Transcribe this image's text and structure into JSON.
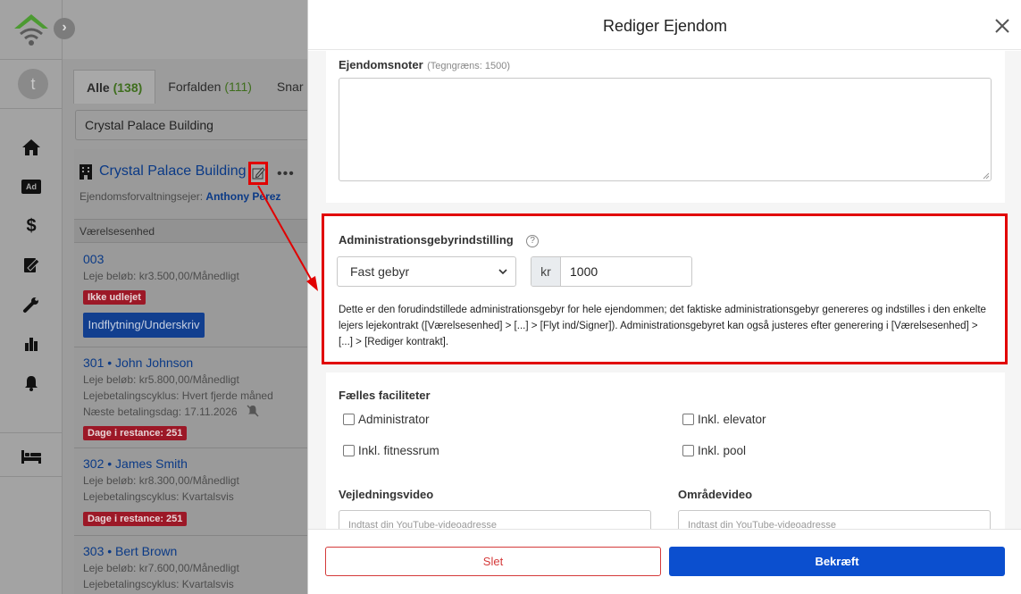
{
  "nav": {
    "avatar_letter": "t",
    "icons": [
      "home-icon",
      "ad-icon",
      "dollar-icon",
      "contract-icon",
      "wrench-icon",
      "chart-icon",
      "bell-icon",
      "bed-icon"
    ],
    "ad_label": "Ad"
  },
  "tabs": [
    {
      "label": "Alle",
      "count": "(138)"
    },
    {
      "label": "Forfalden",
      "count": "(111)"
    },
    {
      "label": "Snar b",
      "count": ""
    }
  ],
  "search": {
    "value": "Crystal Palace Building"
  },
  "property": {
    "name": "Crystal Palace Building",
    "owner_label": "Ejendomsforvaltningsejer:",
    "owner_name": "Anthony Perez",
    "section_header": "Værelsesenhed"
  },
  "units": [
    {
      "title": "003",
      "lines": [
        "Leje beløb: kr3.500,00/Månedligt"
      ],
      "badge": "Ikke udlejet",
      "button": "Indflytning/Underskriv"
    },
    {
      "title": "301 • John Johnson",
      "lines": [
        "Leje beløb: kr5.800,00/Månedligt",
        "Lejebetalingscyklus: Hvert fjerde måned",
        "Næste betalingsdag:  17.11.2026"
      ],
      "badge": "Dage i restance: 251"
    },
    {
      "title": "302 • James Smith",
      "lines": [
        "Leje beløb: kr8.300,00/Månedligt",
        "Lejebetalingscyklus: Kvartalsvis"
      ],
      "badge": "Dage i restance: 251"
    },
    {
      "title": "303 • Bert Brown",
      "lines": [
        "Leje beløb: kr7.600,00/Månedligt",
        "Lejebetalingscyklus: Kvartalsvis"
      ]
    }
  ],
  "modal": {
    "title": "Rediger Ejendom",
    "notes": {
      "label": "Ejendomsnoter",
      "hint": "(Tegngræns: 1500)",
      "value": ""
    },
    "admin_fee": {
      "label": "Administrationsgebyrindstilling",
      "help": "?",
      "type_selected": "Fast gebyr",
      "currency": "kr",
      "amount": "1000",
      "description": "Dette er den forudindstillede administrationsgebyr for hele ejendommen; det faktiske administrationsgebyr genereres og indstilles i den enkelte lejers lejekontrakt ([Værelsesenhed] > [...] > [Flyt ind/Signer]). Administrationsgebyret kan også justeres efter generering i [Værelsesenhed] > [...] > [Rediger kontrakt]."
    },
    "facilities": {
      "label": "Fælles faciliteter",
      "items": [
        {
          "label": "Administrator",
          "checked": false
        },
        {
          "label": "Inkl. elevator",
          "checked": false
        },
        {
          "label": "Inkl. fitnessrum",
          "checked": false
        },
        {
          "label": "Inkl. pool",
          "checked": false
        }
      ]
    },
    "guide_video": {
      "label": "Vejledningsvideo",
      "placeholder": "Indtast din YouTube-videoadresse"
    },
    "area_video": {
      "label": "Områdevideo",
      "placeholder": "Indtast din YouTube-videoadresse"
    },
    "delete_label": "Slet",
    "confirm_label": "Bekræft"
  },
  "colors": {
    "accent": "#0b4fcf",
    "danger": "#d43a3a",
    "highlight": "#e10000"
  }
}
